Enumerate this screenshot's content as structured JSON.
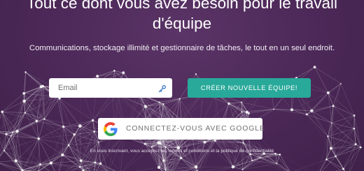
{
  "hero": {
    "headline_line1": "Tout ce dont vous avez besoin pour le travail",
    "headline_line2": "d'équipe",
    "subheadline": "Communications, stockage illimité et gestionnaire de tâches, le tout en un seul endroit."
  },
  "signup": {
    "email_placeholder": "Email",
    "email_value": "",
    "email_field_icon": "key-icon",
    "create_team_label": "CRÉER NOUVELLE ÉQUIPE!",
    "google_icon": "google-g-icon",
    "google_label": "CONNECTEZ-VOUS AVEC GOOGLE",
    "terms_text": "En vous inscrivant, vous acceptez les termes et conditions et la politique de confidentialité"
  },
  "colors": {
    "background": "#4b2857",
    "accent": "#29a99a",
    "network_lines": "#ffffff"
  }
}
